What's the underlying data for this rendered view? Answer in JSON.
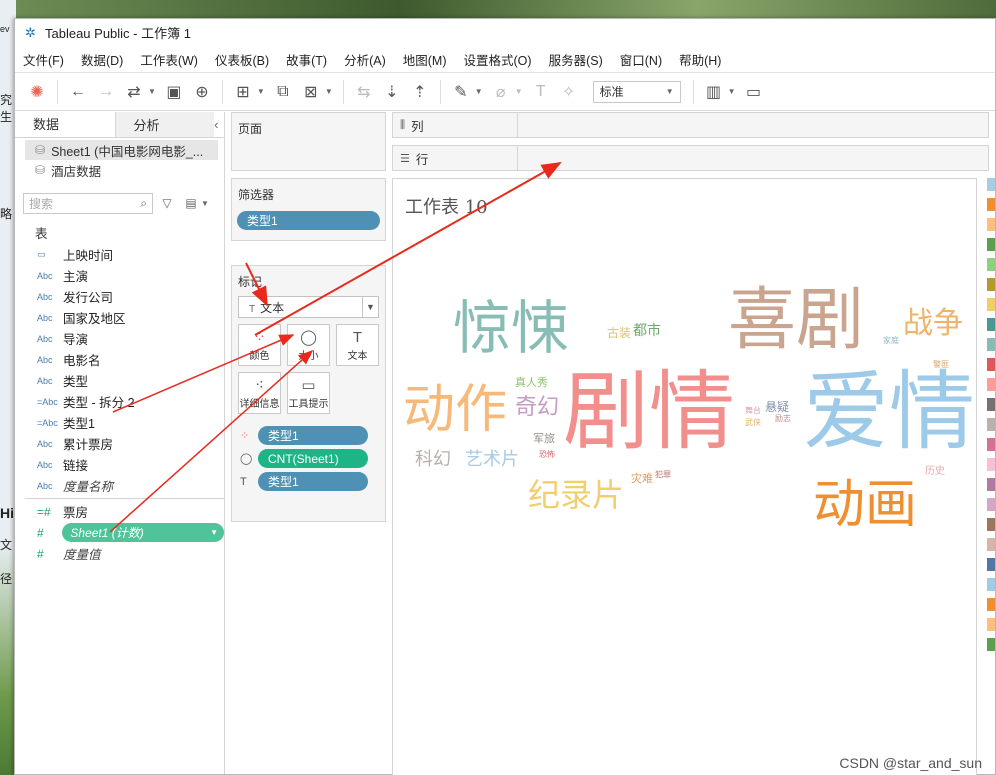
{
  "window": {
    "title": "Tableau Public - 工作簿 1"
  },
  "desktop_fragments": [
    "ev",
    "究生",
    "略",
    "Hi",
    "文",
    "径"
  ],
  "menu": [
    "文件(F)",
    "数据(D)",
    "工作表(W)",
    "仪表板(B)",
    "故事(T)",
    "分析(A)",
    "地图(M)",
    "设置格式(O)",
    "服务器(S)",
    "窗口(N)",
    "帮助(H)"
  ],
  "toolbar": {
    "fit_value": "标准"
  },
  "data_pane": {
    "tab_data": "数据",
    "tab_analysis": "分析",
    "datasources": [
      {
        "label": "Sheet1 (中国电影网电影_..."
      },
      {
        "label": "酒店数据"
      }
    ],
    "search_placeholder": "搜索",
    "section_table": "表",
    "dimensions": [
      {
        "type": "date",
        "type_label": "▭",
        "label": "上映时间"
      },
      {
        "type": "text",
        "type_label": "Abc",
        "label": "主演"
      },
      {
        "type": "text",
        "type_label": "Abc",
        "label": "发行公司"
      },
      {
        "type": "text",
        "type_label": "Abc",
        "label": "国家及地区"
      },
      {
        "type": "text",
        "type_label": "Abc",
        "label": "导演"
      },
      {
        "type": "text",
        "type_label": "Abc",
        "label": "电影名"
      },
      {
        "type": "text",
        "type_label": "Abc",
        "label": "类型"
      },
      {
        "type": "text",
        "type_label": "=Abc",
        "label": "类型 - 拆分 2"
      },
      {
        "type": "text",
        "type_label": "=Abc",
        "label": "类型1"
      },
      {
        "type": "text",
        "type_label": "Abc",
        "label": "累计票房"
      },
      {
        "type": "text",
        "type_label": "Abc",
        "label": "链接"
      },
      {
        "type": "text",
        "type_label": "Abc",
        "label": "度量名称",
        "italic": true
      }
    ],
    "measures": [
      {
        "label": "票房",
        "type_label": "=#"
      },
      {
        "label": "Sheet1 (计数)",
        "type_label": "#",
        "highlight": true
      },
      {
        "label": "度量值",
        "type_label": "#",
        "italic": true
      }
    ]
  },
  "cards": {
    "pages_title": "页面",
    "filters_title": "筛选器",
    "filter_pill": "类型1",
    "marks_title": "标记",
    "mark_type": "文本",
    "mark_buttons": [
      "颜色",
      "大小",
      "文本",
      "详细信息",
      "工具提示"
    ],
    "encodings": [
      {
        "icon": "color",
        "pill": "类型1",
        "style": "blue"
      },
      {
        "icon": "size",
        "pill": "CNT(Sheet1)",
        "style": "green"
      },
      {
        "icon": "text",
        "pill": "类型1",
        "style": "blue"
      }
    ]
  },
  "shelves": {
    "columns_label": "列",
    "rows_label": "行"
  },
  "viz": {
    "title": "工作表 10",
    "words": [
      {
        "text": "剧情",
        "color": "#f28e8c"
      },
      {
        "text": "爱情",
        "color": "#9ccae8"
      },
      {
        "text": "喜剧",
        "color": "#c9a48f"
      },
      {
        "text": "惊悚",
        "color": "#88bdb5"
      },
      {
        "text": "动作",
        "color": "#f6b97a"
      },
      {
        "text": "动画",
        "color": "#ef8f2f"
      },
      {
        "text": "战争",
        "color": "#f0b36a"
      },
      {
        "text": "纪录片",
        "color": "#f2cf6e"
      },
      {
        "text": "奇幻",
        "color": "#c79bc4"
      },
      {
        "text": "科幻",
        "color": "#b8b0ab"
      },
      {
        "text": "艺术片",
        "color": "#a8cbe6"
      },
      {
        "text": "都市",
        "color": "#6fa86a"
      },
      {
        "text": "古装",
        "color": "#d6c36c"
      },
      {
        "text": "真人秀",
        "color": "#8cc36c"
      },
      {
        "text": "军旅",
        "color": "#9a8e86"
      },
      {
        "text": "悬疑",
        "color": "#7f8fb0"
      },
      {
        "text": "灾难",
        "color": "#e39a55"
      },
      {
        "text": "历史",
        "color": "#f0a8a8"
      },
      {
        "text": "家庭",
        "color": "#8fb8c8"
      },
      {
        "text": "恐怖",
        "color": "#d65f5f"
      },
      {
        "text": "舞台",
        "color": "#d4a0b8"
      },
      {
        "text": "武侠",
        "color": "#e0b070"
      },
      {
        "text": "励志",
        "color": "#c08f8f"
      },
      {
        "text": "犯罪",
        "color": "#c07070"
      },
      {
        "text": "警匪",
        "color": "#d9a56b"
      }
    ]
  },
  "legend_colors": [
    "#a6cee3",
    "#f28e2b",
    "#ffbe7d",
    "#59a14f",
    "#8cd17d",
    "#b6992d",
    "#f1ce63",
    "#499894",
    "#86bcb6",
    "#e15759",
    "#ff9d9a",
    "#79706e",
    "#bab0ac",
    "#d37295",
    "#fabfd2",
    "#b07aa1",
    "#d4a6c8",
    "#9d7660",
    "#d7b5a6",
    "#4e79a7",
    "#a0cbe8",
    "#f28e2b",
    "#ffbe7d",
    "#59a14f"
  ],
  "watermark": "CSDN @star_and_sun"
}
